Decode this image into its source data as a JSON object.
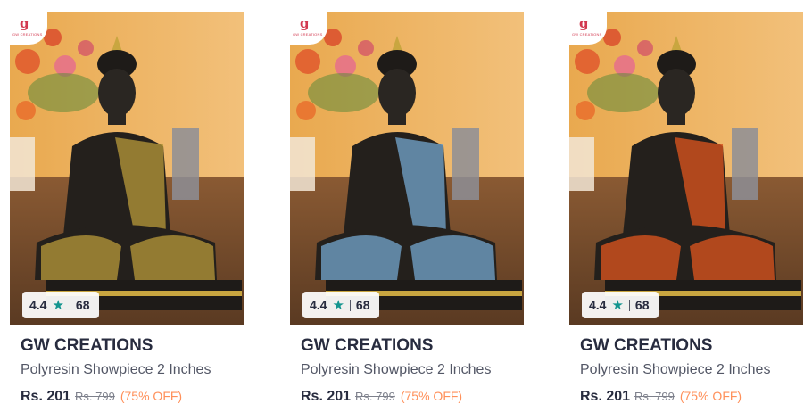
{
  "products": [
    {
      "brand": "GW CREATIONS",
      "name": "Polyresin Showpiece 2 Inches",
      "price": "Rs. 201",
      "mrp": "Rs. 799",
      "discount": "(75% OFF)",
      "rating": "4.4",
      "rating_count": "68",
      "logo_letter": "g",
      "logo_text": "GW CREATIONS",
      "variant": "gold",
      "pattern_color": "#b89a3a"
    },
    {
      "brand": "GW CREATIONS",
      "name": "Polyresin Showpiece 2 Inches",
      "price": "Rs. 201",
      "mrp": "Rs. 799",
      "discount": "(75% OFF)",
      "rating": "4.4",
      "rating_count": "68",
      "logo_letter": "g",
      "logo_text": "GW CREATIONS",
      "variant": "blue",
      "pattern_color": "#6f9fc4"
    },
    {
      "brand": "GW CREATIONS",
      "name": "Polyresin Showpiece 2 Inches",
      "price": "Rs. 201",
      "mrp": "Rs. 799",
      "discount": "(75% OFF)",
      "rating": "4.4",
      "rating_count": "68",
      "logo_letter": "g",
      "logo_text": "GW CREATIONS",
      "variant": "orange",
      "pattern_color": "#d5521e"
    }
  ],
  "colors": {
    "star": "#14958f",
    "discount": "#ff905a",
    "brand_text": "#282c3f"
  }
}
